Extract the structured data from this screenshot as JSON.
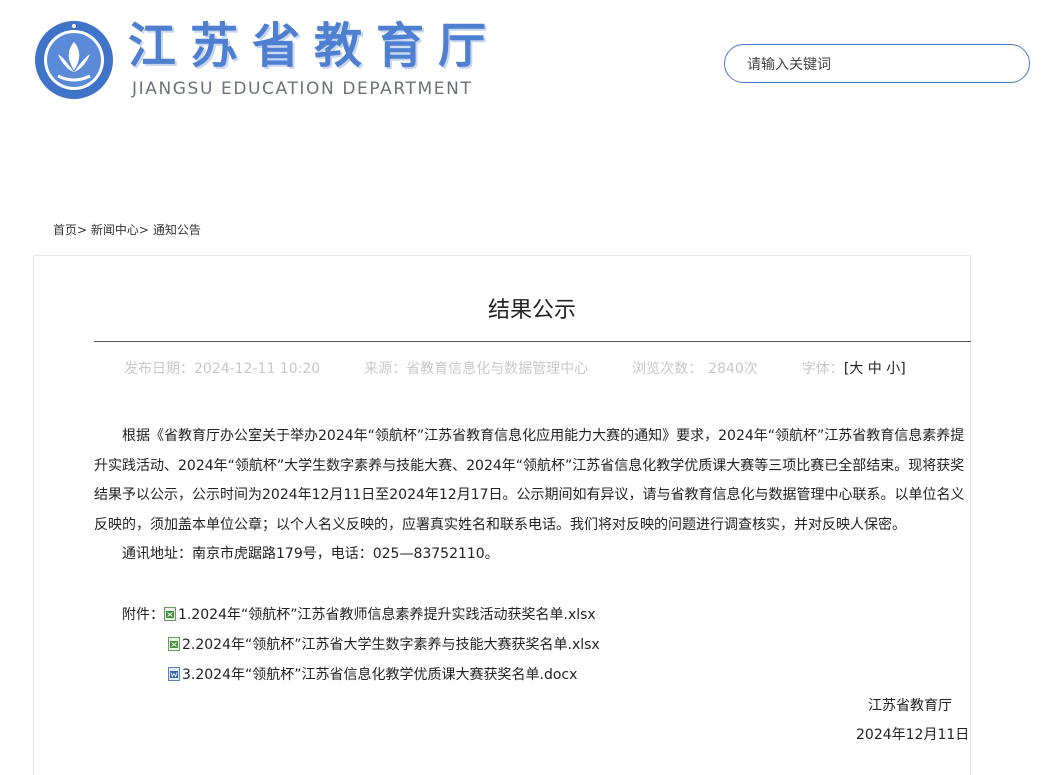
{
  "header": {
    "logo_cn": "江苏省教育厅",
    "logo_en": "JIANGSU EDUCATION DEPARTMENT",
    "search_placeholder": "请输入关键词"
  },
  "breadcrumb": {
    "items": [
      "首页",
      "新闻中心",
      "通知公告"
    ],
    "separator": ">"
  },
  "article": {
    "title": "结果公示",
    "meta": {
      "date_label": "发布日期：",
      "date": "2024-12-11 10:20",
      "source_label": "来源：",
      "source": "省教育信息化与数据管理中心",
      "views_label": "浏览次数：",
      "views": "2840次",
      "font_label": "字体：",
      "font_sizes": [
        "大",
        "中",
        "小"
      ]
    },
    "paragraph": "根据《省教育厅办公室关于举办2024年“领航杯”江苏省教育信息化应用能力大赛的通知》要求，2024年“领航杯”江苏省教育信息素养提升实践活动、2024年“领航杯”大学生数字素养与技能大赛、2024年“领航杯”江苏省信息化教学优质课大赛等三项比赛已全部结束。现将获奖结果予以公示，公示时间为2024年12月11日至2024年12月17日。公示期间如有异议，请与省教育信息化与数据管理中心联系。以单位名义反映的，须加盖本单位公章；以个人名义反映的，应署真实姓名和联系电话。我们将对反映的问题进行调查核实，并对反映人保密。",
    "address": "通讯地址：南京市虎踞路179号，电话：025—83752110。",
    "attachments_label": "附件：",
    "attachments": [
      {
        "name": "1.2024年“领航杯”江苏省教师信息素养提升实践活动获奖名单.xlsx",
        "type": "excel-icon"
      },
      {
        "name": "2.2024年“领航杯”江苏省大学生数字素养与技能大赛获奖名单.xlsx",
        "type": "excel-icon"
      },
      {
        "name": "3.2024年“领航杯”江苏省信息化教学优质课大赛获奖名单.docx",
        "type": "word-icon"
      }
    ],
    "signature_org": "江苏省教育厅",
    "signature_date": "2024年12月11日"
  },
  "colors": {
    "brand_blue": "#4f7fd0",
    "meta_gray": "#c8c8c8",
    "text": "#222222"
  }
}
